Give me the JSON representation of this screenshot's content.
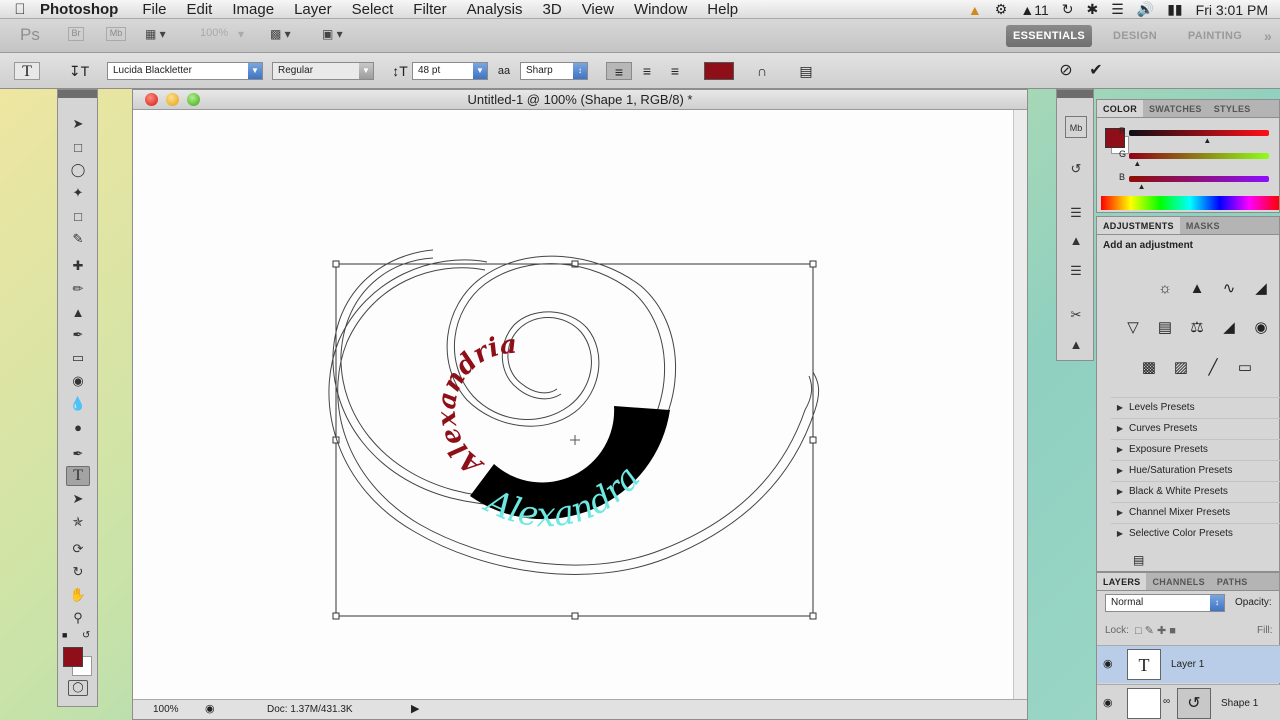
{
  "menubar": {
    "app_name": "Photoshop",
    "menus": [
      "File",
      "Edit",
      "Image",
      "Layer",
      "Select",
      "Filter",
      "Analysis",
      "3D",
      "View",
      "Window",
      "Help"
    ],
    "status_number": "11",
    "clock": "Fri 3:01 PM"
  },
  "appbar": {
    "ps_logo": "Ps",
    "zoom": "100%",
    "workspaces": [
      "ESSENTIALS",
      "DESIGN",
      "PAINTING"
    ],
    "more": "»"
  },
  "options": {
    "tool_glyph": "T",
    "font_family": "Lucida Blackletter",
    "font_style": "Regular",
    "font_size": "48 pt",
    "aa_label": "aa",
    "antialias": "Sharp",
    "text_color": "#8e0f17"
  },
  "document": {
    "title": "Untitled-1 @ 100% (Shape 1, RGB/8) *",
    "zoom": "100%",
    "doc_size": "Doc: 1.37M/431.3K",
    "spiral_text_dark": "Alexandria",
    "spiral_text_light": "Alexandra",
    "dark_text_color": "#8e0f17",
    "light_text_color": "#6ee8e0"
  },
  "color_panel": {
    "tabs": [
      "COLOR",
      "SWATCHES",
      "STYLES"
    ],
    "channels": [
      {
        "label": "R",
        "value": 0.56
      },
      {
        "label": "G",
        "value": 0.06
      },
      {
        "label": "B",
        "value": 0.09
      }
    ],
    "foreground": "#8e0f17",
    "background": "#ffffff"
  },
  "adjustments_panel": {
    "tabs": [
      "ADJUSTMENTS",
      "MASKS"
    ],
    "heading": "Add an adjustment",
    "presets": [
      "Levels Presets",
      "Curves Presets",
      "Exposure Presets",
      "Hue/Saturation Presets",
      "Black & White Presets",
      "Channel Mixer Presets",
      "Selective Color Presets"
    ]
  },
  "layers_panel": {
    "tabs": [
      "LAYERS",
      "CHANNELS",
      "PATHS"
    ],
    "blend_mode": "Normal",
    "opacity_label": "Opacity:",
    "lock_label": "Lock:",
    "fill_label": "Fill:",
    "layers": [
      {
        "name": "Layer 1",
        "thumb": "T"
      },
      {
        "name": "Shape 1",
        "thumb": ""
      }
    ]
  }
}
